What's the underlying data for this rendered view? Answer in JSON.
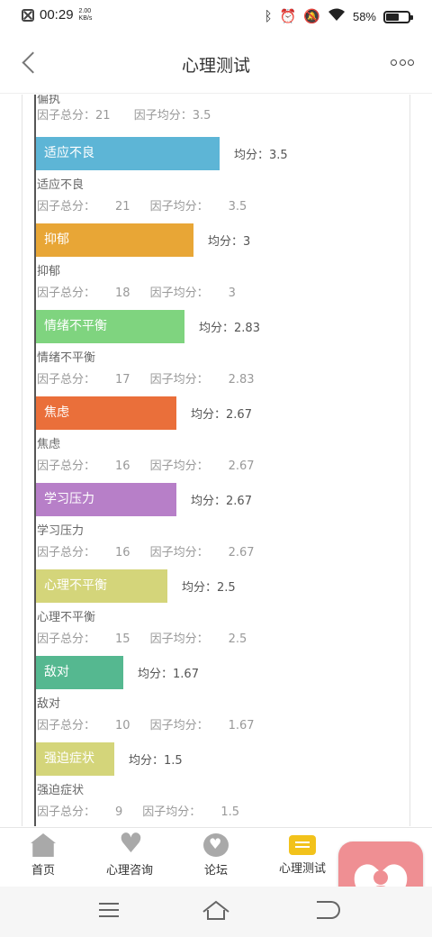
{
  "status_bar": {
    "time": "00:29",
    "speed_value": "2.00",
    "speed_unit": "KB/s",
    "battery_pct": "58%",
    "battery_level": 0.58,
    "icons": [
      "close-notification-icon",
      "bluetooth-icon",
      "alarm-icon",
      "mute-icon",
      "wifi-icon",
      "battery-icon"
    ]
  },
  "header": {
    "title": "心理测试"
  },
  "chart_data": {
    "type": "bar",
    "orientation": "horizontal",
    "truncated_top_item": {
      "name": "偏执",
      "total_label": "因子总分：",
      "total": 21,
      "avg_label": "因子均分：",
      "avg": 3.5
    },
    "avg_prefix": "均分：",
    "total_prefix": "因子总分：",
    "factor_avg_prefix": "因子均分：",
    "items": [
      {
        "name": "适应不良",
        "avg": 3.5,
        "avg_text": "3.5",
        "total": 21,
        "total_text": "21",
        "color": "#5db5d6"
      },
      {
        "name": "抑郁",
        "avg": 3,
        "avg_text": "3",
        "total": 18,
        "total_text": "18",
        "color": "#e8a636"
      },
      {
        "name": "情绪不平衡",
        "avg": 2.83,
        "avg_text": "2.83",
        "total": 17,
        "total_text": "17",
        "color": "#7fd47f"
      },
      {
        "name": "焦虑",
        "avg": 2.67,
        "avg_text": "2.67",
        "total": 16,
        "total_text": "16",
        "color": "#ea6f3a"
      },
      {
        "name": "学习压力",
        "avg": 2.67,
        "avg_text": "2.67",
        "total": 16,
        "total_text": "16",
        "color": "#b77fc8"
      },
      {
        "name": "心理不平衡",
        "avg": 2.5,
        "avg_text": "2.5",
        "total": 15,
        "total_text": "15",
        "color": "#d4d57a"
      },
      {
        "name": "敌对",
        "avg": 1.67,
        "avg_text": "1.67",
        "total": 10,
        "total_text": "10",
        "color": "#55b890"
      },
      {
        "name": "强迫症状",
        "avg": 1.5,
        "avg_text": "1.5",
        "total": 9,
        "total_text": "9",
        "color": "#d4d57a"
      }
    ]
  },
  "tabbar": {
    "items": [
      {
        "label": "首页",
        "icon": "home-icon"
      },
      {
        "label": "心理咨询",
        "icon": "heart-consult-icon"
      },
      {
        "label": "论坛",
        "icon": "forum-icon"
      },
      {
        "label": "心理测试",
        "icon": "test-icon",
        "active": true
      }
    ]
  },
  "float_button": {
    "icon": "heart-person-icon",
    "color": "#ef8f93"
  },
  "system_nav": {
    "icons": [
      "menu-icon",
      "home-nav-icon",
      "back-nav-icon"
    ]
  }
}
